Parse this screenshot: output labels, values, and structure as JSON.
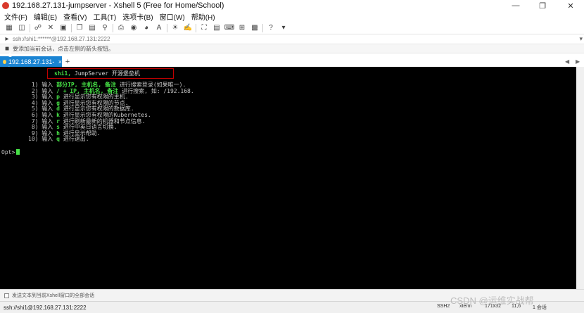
{
  "window": {
    "title": "192.168.27.131-jumpserver - Xshell 5 (Free for Home/School)"
  },
  "menu": [
    {
      "label": "文件(F)"
    },
    {
      "label": "编辑(E)"
    },
    {
      "label": "查看(V)"
    },
    {
      "label": "工具(T)"
    },
    {
      "label": "选项卡(B)"
    },
    {
      "label": "窗口(W)"
    },
    {
      "label": "帮助(H)"
    }
  ],
  "address": {
    "text": "ssh://shi1:******@192.168.27.131:2222"
  },
  "hint": {
    "text": "要添加当前会话，点击左侧的箭头按钮。"
  },
  "tabs": [
    {
      "label": "1 192.168.27.131-j..."
    }
  ],
  "terminal": {
    "banner_user": "shi1,",
    "banner_product": "JumpServer",
    "banner_suffix": "开源堡垒机",
    "menu": [
      {
        "num": " 1)",
        "pre": " 输入 ",
        "key": "部分IP, 主机名, 备注",
        "post": " 进行搜索登录(如果唯一)."
      },
      {
        "num": " 2)",
        "pre": " 输入 ",
        "key": "/ + IP, 主机名, 备注",
        "post": " 进行搜索, 如: /192.168."
      },
      {
        "num": " 3)",
        "pre": " 输入 ",
        "key": "p",
        "post": " 进行显示您有权限的主机."
      },
      {
        "num": " 4)",
        "pre": " 输入 ",
        "key": "g",
        "post": " 进行显示您有权限的节点."
      },
      {
        "num": " 5)",
        "pre": " 输入 ",
        "key": "d",
        "post": " 进行显示您有权限的数据库."
      },
      {
        "num": " 6)",
        "pre": " 输入 ",
        "key": "k",
        "post": " 进行显示您有权限的Kubernetes."
      },
      {
        "num": " 7)",
        "pre": " 输入 ",
        "key": "r",
        "post": " 进行刷新最新的机器和节点信息."
      },
      {
        "num": " 8)",
        "pre": " 输入 ",
        "key": "s",
        "post": " 进行中英日语言切换."
      },
      {
        "num": " 9)",
        "pre": " 输入 ",
        "key": "h",
        "post": " 进行显示帮助."
      },
      {
        "num": "10)",
        "pre": " 输入 ",
        "key": "q",
        "post": " 进行退出."
      }
    ],
    "prompt": "Opt>"
  },
  "send_bar": {
    "text": "发送文本到当前Xshell窗口的全部会话"
  },
  "status": {
    "connection": "ssh://shi1@192.168.27.131:2222",
    "protocol": "SSH2",
    "term": "xterm",
    "size": "171x32",
    "position": "11,6",
    "sessions": "1 会话"
  },
  "watermark": "CSDN @运维实战帮",
  "colors": {
    "tab_active": "#1a84d3",
    "terminal_bg": "#000000",
    "highlight_green": "#46e046",
    "banner_border": "#c00000"
  }
}
